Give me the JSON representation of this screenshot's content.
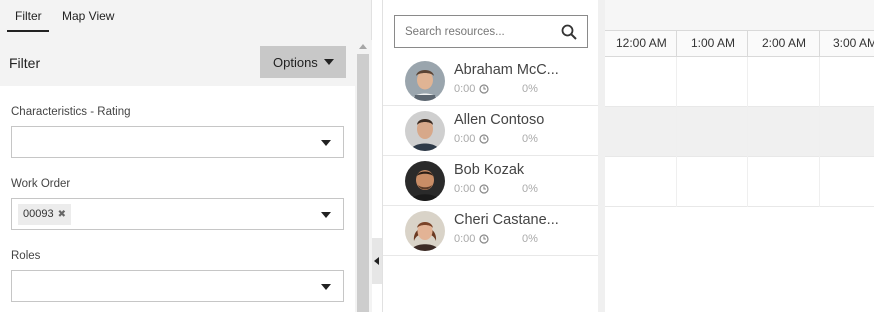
{
  "left_panel": {
    "tabs": [
      {
        "label": "Filter",
        "active": true
      },
      {
        "label": "Map View",
        "active": false
      }
    ],
    "filter_title": "Filter",
    "options_label": "Options",
    "fields": [
      {
        "label": "Characteristics - Rating",
        "value": ""
      },
      {
        "label": "Work Order",
        "tags": [
          "00093"
        ]
      },
      {
        "label": "Roles",
        "value": ""
      }
    ]
  },
  "resources": {
    "search_placeholder": "Search resources...",
    "items": [
      {
        "name": "Abraham McC...",
        "hours": "0:00",
        "utilization": "0%"
      },
      {
        "name": "Allen Contoso",
        "hours": "0:00",
        "utilization": "0%"
      },
      {
        "name": "Bob Kozak",
        "hours": "0:00",
        "utilization": "0%"
      },
      {
        "name": "Cheri Castane...",
        "hours": "0:00",
        "utilization": "0%"
      }
    ]
  },
  "timeline": {
    "hours": [
      "12:00 AM",
      "1:00 AM",
      "2:00 AM",
      "3:00 AM"
    ]
  },
  "colors": {
    "panel_bg": "#f3f3f3",
    "options_bg": "#c8c8c8",
    "shaded_row": "#f0f0f0"
  }
}
